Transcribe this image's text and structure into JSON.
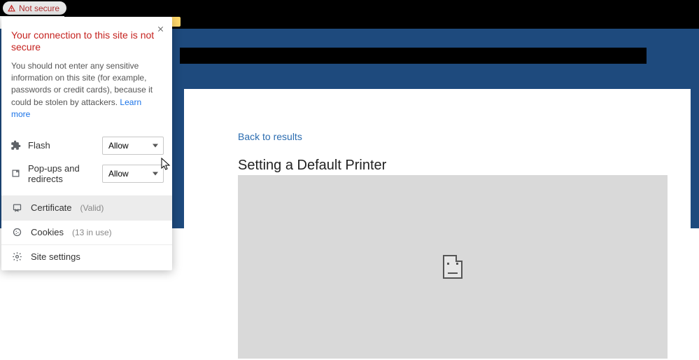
{
  "address": {
    "not_secure_label": "Not secure"
  },
  "popup": {
    "title": "Your connection to this site is not secure",
    "desc_before": "You should not enter any sensitive information on this site (for example, passwords or credit cards), because it could be stolen by attackers. ",
    "learn_more": "Learn more",
    "permissions": {
      "flash": {
        "label": "Flash",
        "value": "Allow"
      },
      "popups": {
        "label": "Pop-ups and redirects",
        "value": "Allow"
      }
    },
    "certificate": {
      "label": "Certificate",
      "status": "(Valid)"
    },
    "cookies": {
      "label": "Cookies",
      "count": "(13 in use)"
    },
    "site_settings": {
      "label": "Site settings"
    }
  },
  "content": {
    "back_link": "Back to results",
    "title": "Setting a Default Printer"
  }
}
